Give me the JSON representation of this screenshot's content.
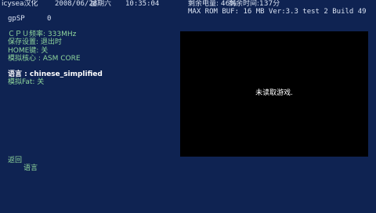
{
  "header": {
    "title": "icysea汉化",
    "date": "2008/06/28",
    "weekday": "星期六",
    "time": "10:35:04",
    "battery": "剩余电量: 46%",
    "remaining_time": "剩余时间:137分",
    "rom_info": "MAX ROM BUF: 16 MB Ver:3.3 test 2 Build 49"
  },
  "status": {
    "label": "gpSP",
    "value": "0"
  },
  "menu": {
    "cpu": "ＣＰＵ频率: 333MHz",
    "save": "保存设置: 退出时",
    "home": "HOME键: 关",
    "core": "模拟核心 : ASM CORE",
    "language": "语言 : chinese_simplified",
    "fat": "模拟Fat: 关"
  },
  "preview": {
    "message": "未读取游戏."
  },
  "footer": {
    "back": "返回",
    "language": "语言"
  },
  "colors": {
    "background": "#0f2352",
    "preview_bg": "#000000",
    "menu_text": "#8fd59b",
    "selected_text": "#ffffff"
  }
}
